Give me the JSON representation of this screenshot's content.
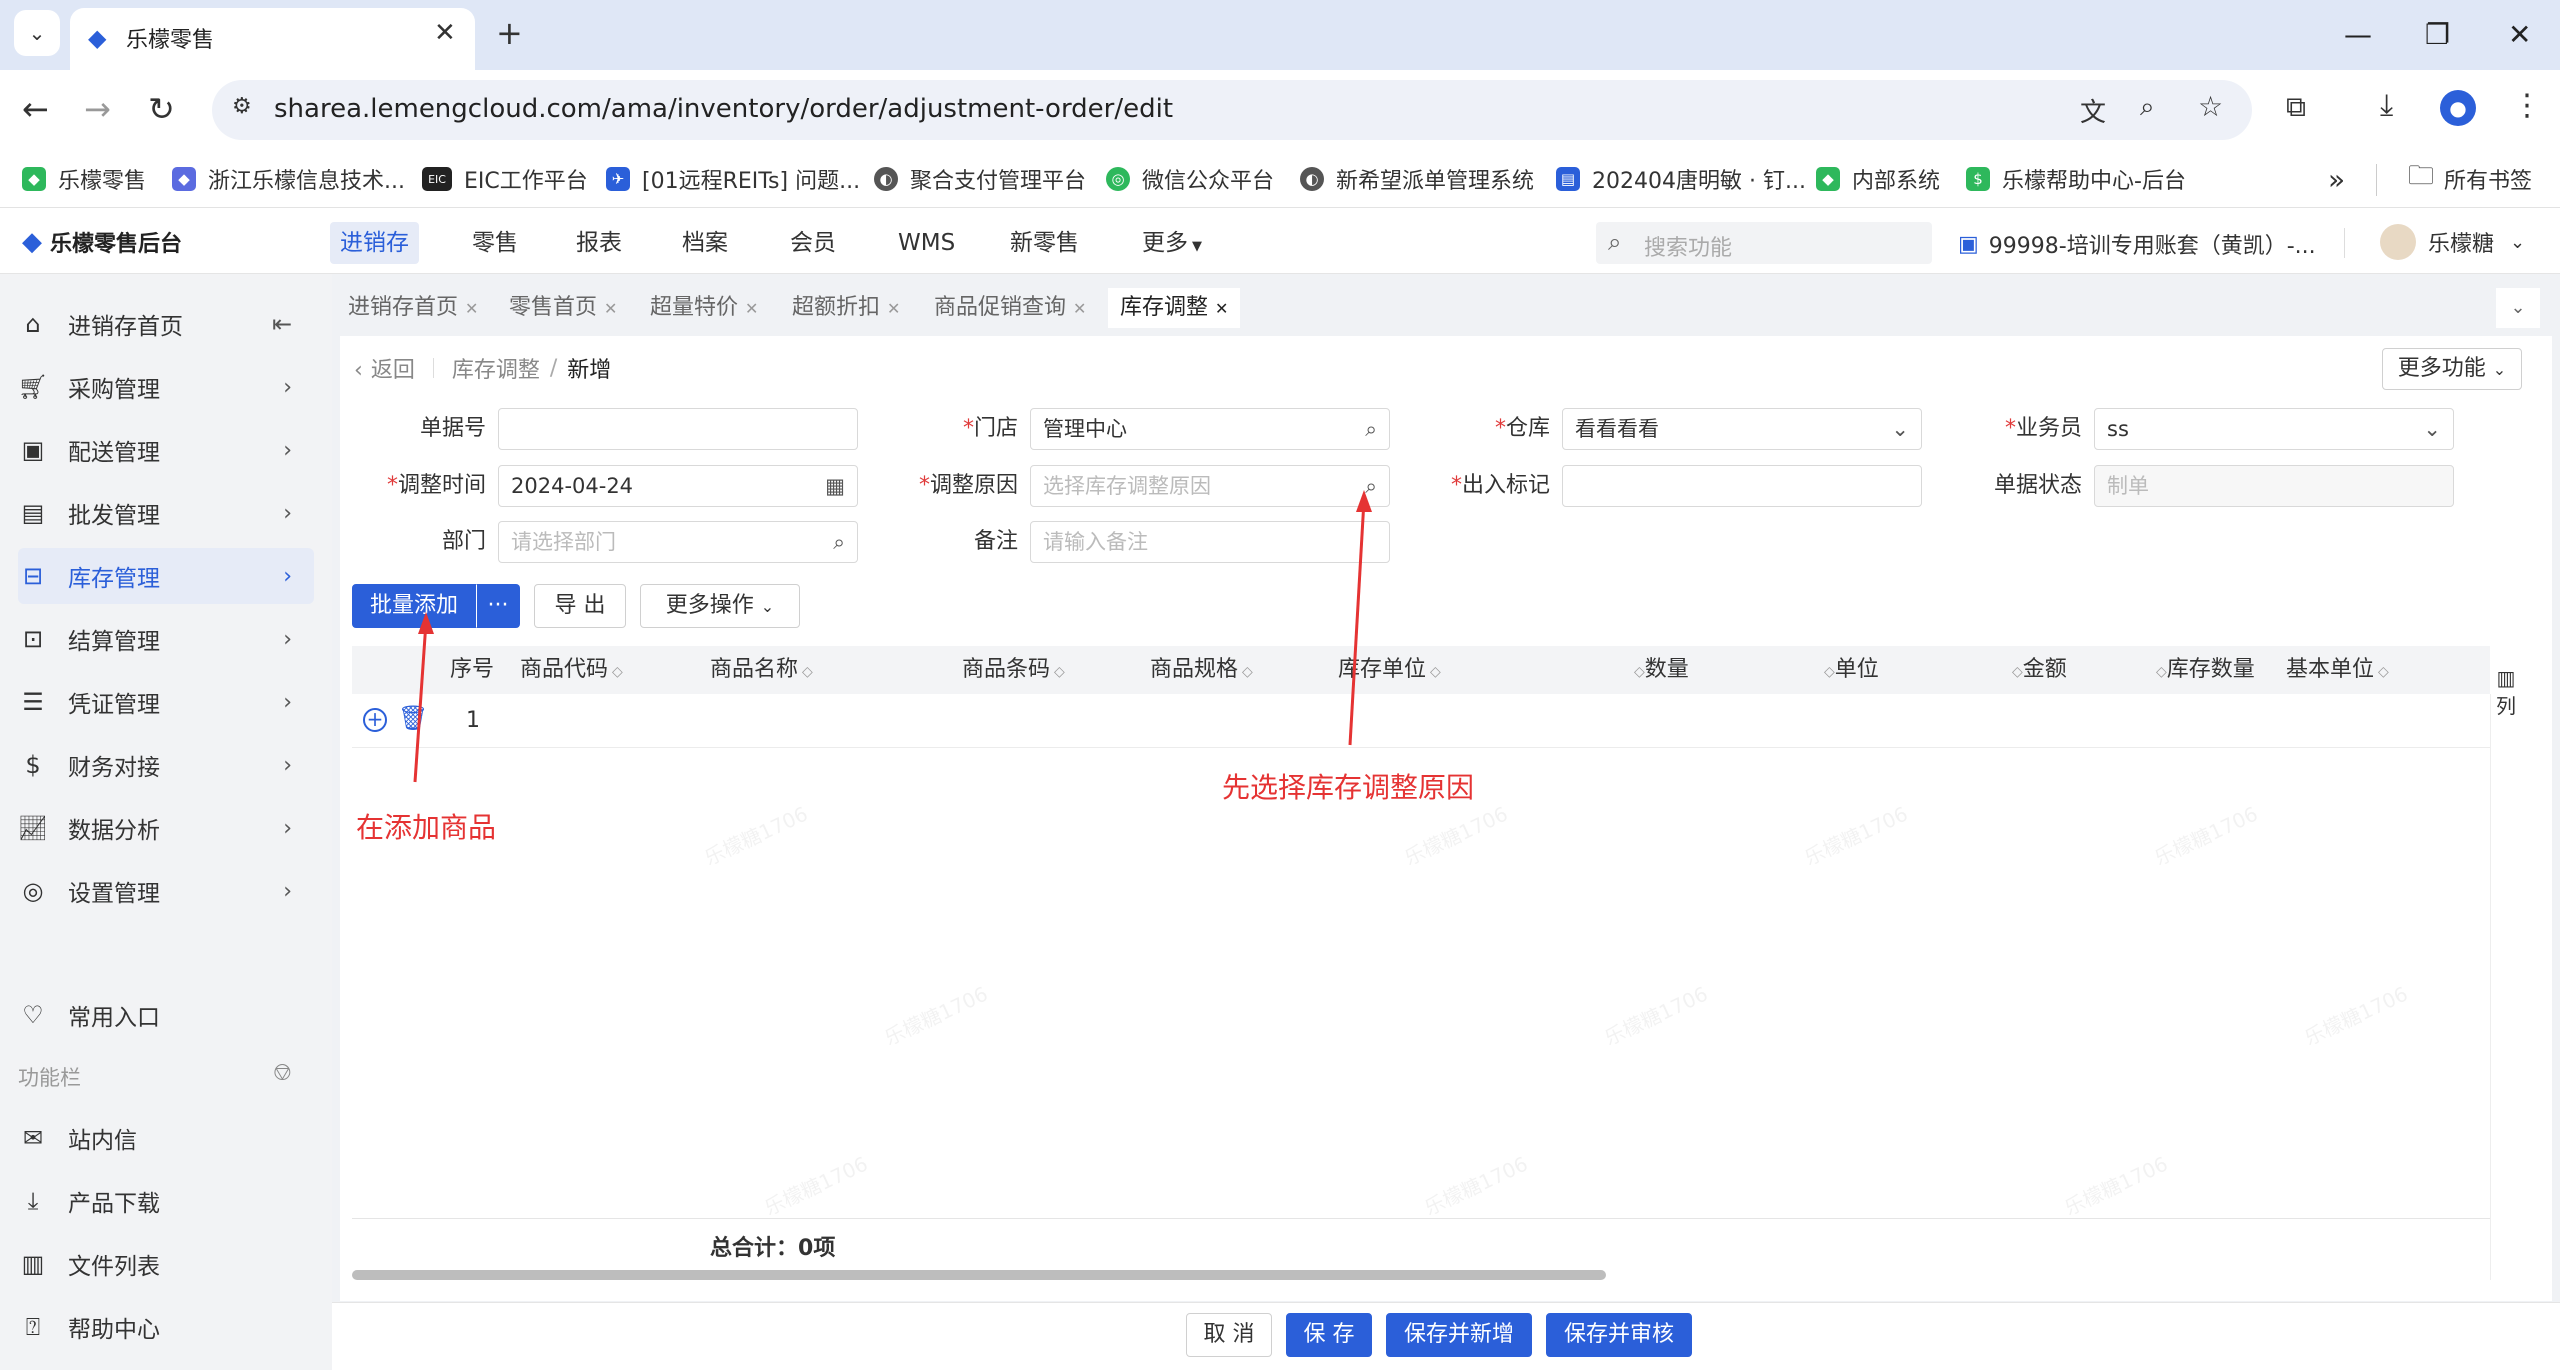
{
  "browser": {
    "tab_title": "乐檬零售",
    "url": "sharea.lemengcloud.com/ama/inventory/order/adjustment-order/edit",
    "bookmarks": [
      {
        "label": "乐檬零售",
        "color": "#2eb85c"
      },
      {
        "label": "浙江乐檬信息技术...",
        "color": "#5b6be0"
      },
      {
        "label": "EIC工作平台",
        "color": "#222222"
      },
      {
        "label": "[01远程REITs] 问题...",
        "color": "#2b5fd9"
      },
      {
        "label": "聚合支付管理平台",
        "color": "#555555"
      },
      {
        "label": "微信公众平台",
        "color": "#2eb85c"
      },
      {
        "label": "新希望派单管理系统",
        "color": "#555555"
      },
      {
        "label": "202404唐明敏 · 钉...",
        "color": "#2b5fd9"
      },
      {
        "label": "内部系统",
        "color": "#2eb85c"
      },
      {
        "label": "乐檬帮助中心-后台",
        "color": "#2eb85c"
      }
    ],
    "all_bookmarks": "所有书签",
    "more_bookmarks": "»"
  },
  "app": {
    "logo": "乐檬零售后台",
    "nav": [
      "进销存",
      "零售",
      "报表",
      "档案",
      "会员",
      "WMS",
      "新零售",
      "更多"
    ],
    "search_placeholder": "搜索功能",
    "account": "99998-培训专用账套（黄凯）-...",
    "user": "乐檬糖"
  },
  "sidebar": {
    "items": [
      {
        "label": "进销存首页",
        "icon": "home-icon"
      },
      {
        "label": "采购管理",
        "icon": "cart-icon"
      },
      {
        "label": "配送管理",
        "icon": "delivery-icon"
      },
      {
        "label": "批发管理",
        "icon": "wholesale-icon"
      },
      {
        "label": "库存管理",
        "icon": "inventory-icon"
      },
      {
        "label": "结算管理",
        "icon": "settle-icon"
      },
      {
        "label": "凭证管理",
        "icon": "voucher-icon"
      },
      {
        "label": "财务对接",
        "icon": "finance-icon"
      },
      {
        "label": "数据分析",
        "icon": "chart-icon"
      },
      {
        "label": "设置管理",
        "icon": "settings-icon"
      }
    ],
    "favorites": "常用入口",
    "function_bar": "功能栏",
    "bottom_items": [
      {
        "label": "站内信",
        "icon": "mail-icon"
      },
      {
        "label": "产品下载",
        "icon": "download-icon"
      },
      {
        "label": "文件列表",
        "icon": "file-list-icon"
      },
      {
        "label": "帮助中心",
        "icon": "help-icon"
      }
    ]
  },
  "page_tabs": [
    "进销存首页",
    "零售首页",
    "超量特价",
    "超额折扣",
    "商品促销查询",
    "库存调整"
  ],
  "breadcrumb": {
    "back": "返回",
    "parent": "库存调整",
    "sep": "/",
    "current": "新增"
  },
  "more_functions": "更多功能",
  "form": {
    "doc_no": {
      "label": "单据号",
      "value": ""
    },
    "store": {
      "label": "门店",
      "value": "管理中心"
    },
    "warehouse": {
      "label": "仓库",
      "value": "看看看看"
    },
    "salesperson": {
      "label": "业务员",
      "value": "ss"
    },
    "adjust_time": {
      "label": "调整时间",
      "value": "2024-04-24"
    },
    "adjust_reason": {
      "label": "调整原因",
      "placeholder": "选择库存调整原因"
    },
    "io_flag": {
      "label": "出入标记",
      "value": ""
    },
    "doc_status": {
      "label": "单据状态",
      "placeholder": "制单"
    },
    "department": {
      "label": "部门",
      "placeholder": "请选择部门"
    },
    "remark": {
      "label": "备注",
      "placeholder": "请输入备注"
    }
  },
  "actions": {
    "batch_add": "批量添加",
    "more_dots": "···",
    "export": "导 出",
    "more_ops": "更多操作"
  },
  "table": {
    "headers": [
      "序号",
      "商品代码",
      "商品名称",
      "商品条码",
      "商品规格",
      "库存单位",
      "数量",
      "单位",
      "金额",
      "库存数量",
      "基本单位"
    ],
    "columns_btn": "列",
    "rows": [
      {
        "index": "1"
      }
    ],
    "total_label": "总合计：",
    "total_value": "0项"
  },
  "annotations": {
    "add_goods": "在添加商品",
    "choose_reason": "先选择库存调整原因"
  },
  "footer": {
    "cancel": "取 消",
    "save": "保 存",
    "save_new": "保存并新增",
    "save_audit": "保存并审核"
  },
  "watermark": "乐檬糖1706"
}
